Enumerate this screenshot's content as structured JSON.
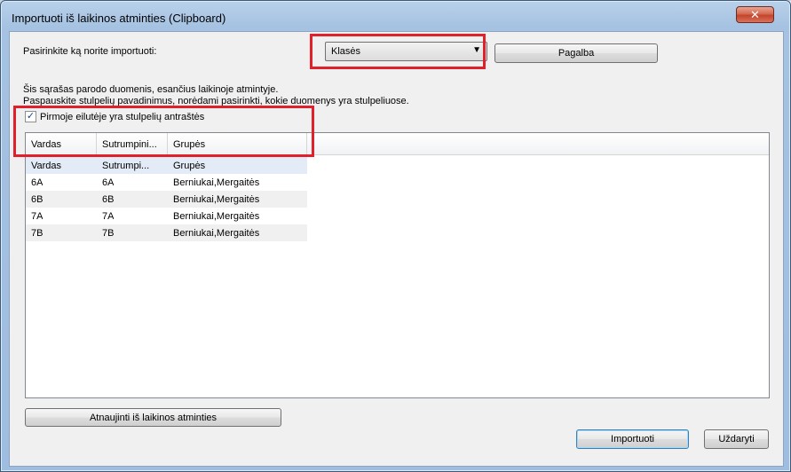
{
  "window": {
    "title": "Importuoti iš laikinos atminties (Clipboard)",
    "close_glyph": "✕"
  },
  "import_choice": {
    "label": "Pasirinkite ką norite importuoti:",
    "selected": "Klasės"
  },
  "help_button": "Pagalba",
  "info": {
    "line1": "Šis sąrašas parodo duomenis, esančius laikinoje atmintyje.",
    "line2": "Paspauskite stulpelių pavadinimus, norėdami pasirinkti, kokie duomenys yra stulpeliuose."
  },
  "first_row_checkbox": {
    "checked": true,
    "label": "Pirmoje eilutėje yra stulpelių antraštės"
  },
  "table": {
    "columns": [
      "Vardas",
      "Sutrumpini...",
      "Grupės"
    ],
    "rows": [
      [
        "Vardas",
        "Sutrumpi...",
        "Grupės"
      ],
      [
        "6A",
        "6A",
        "Berniukai,Mergaitės"
      ],
      [
        "6B",
        "6B",
        "Berniukai,Mergaitės"
      ],
      [
        "7A",
        "7A",
        "Berniukai,Mergaitės"
      ],
      [
        "7B",
        "7B",
        "Berniukai,Mergaitės"
      ]
    ]
  },
  "refresh_button": "Atnaujinti iš laikinos atminties",
  "import_button": "Importuoti",
  "close_button": "Uždaryti",
  "colors": {
    "highlight": "#e0202a",
    "selected_row": "#e3ecf6"
  }
}
